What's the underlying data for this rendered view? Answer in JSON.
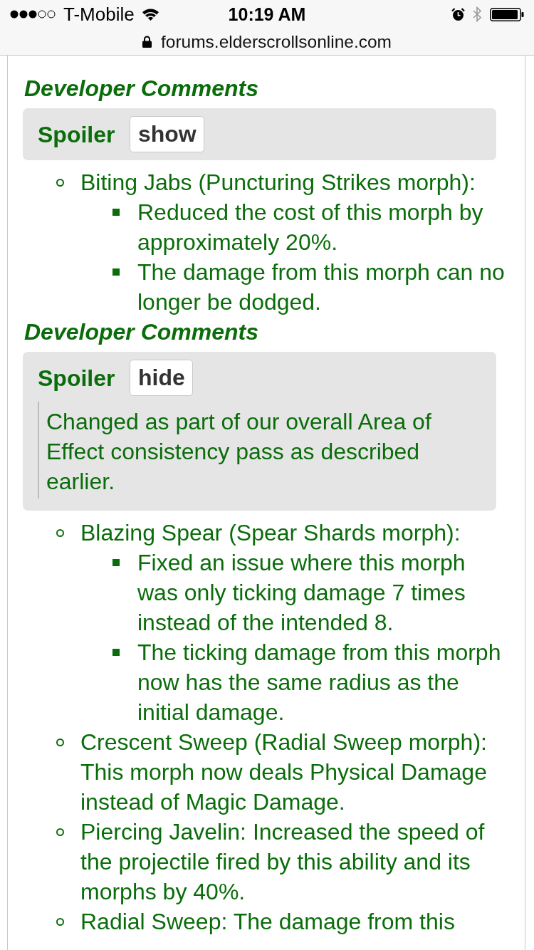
{
  "status_bar": {
    "carrier": "T-Mobile",
    "time": "10:19 AM"
  },
  "address_bar": {
    "url": "forums.elderscrollsonline.com"
  },
  "post": {
    "blocks": [
      {
        "kind": "heading",
        "text": "Developer Comments"
      },
      {
        "kind": "spoiler",
        "label": "Spoiler",
        "button": "show",
        "expanded": false
      },
      {
        "kind": "list",
        "items": [
          {
            "text": "Biting Jabs (Puncturing Strikes morph):",
            "children": [
              {
                "text": "Reduced the cost of this morph by approximately 20%."
              },
              {
                "text": "The damage from this morph can no longer be dodged."
              }
            ]
          }
        ]
      },
      {
        "kind": "heading",
        "text": "Developer Comments"
      },
      {
        "kind": "spoiler",
        "label": "Spoiler",
        "button": "hide",
        "expanded": true,
        "content": "Changed as part of our overall Area of Effect consistency pass as described earlier."
      },
      {
        "kind": "list",
        "items": [
          {
            "text": "Blazing Spear (Spear Shards morph):",
            "children": [
              {
                "text": "Fixed an issue where this morph was only ticking damage 7 times instead of the intended 8."
              },
              {
                "text": "The ticking damage from this morph now has the same radius as the initial damage."
              }
            ]
          },
          {
            "text": "Crescent Sweep (Radial Sweep morph): This morph now deals Physical Damage instead of Magic Damage."
          },
          {
            "text": "Piercing Javelin: Increased the speed of the projectile fired by this ability and its morphs by 40%."
          },
          {
            "text": "Radial Sweep: The damage from this"
          }
        ]
      }
    ]
  }
}
